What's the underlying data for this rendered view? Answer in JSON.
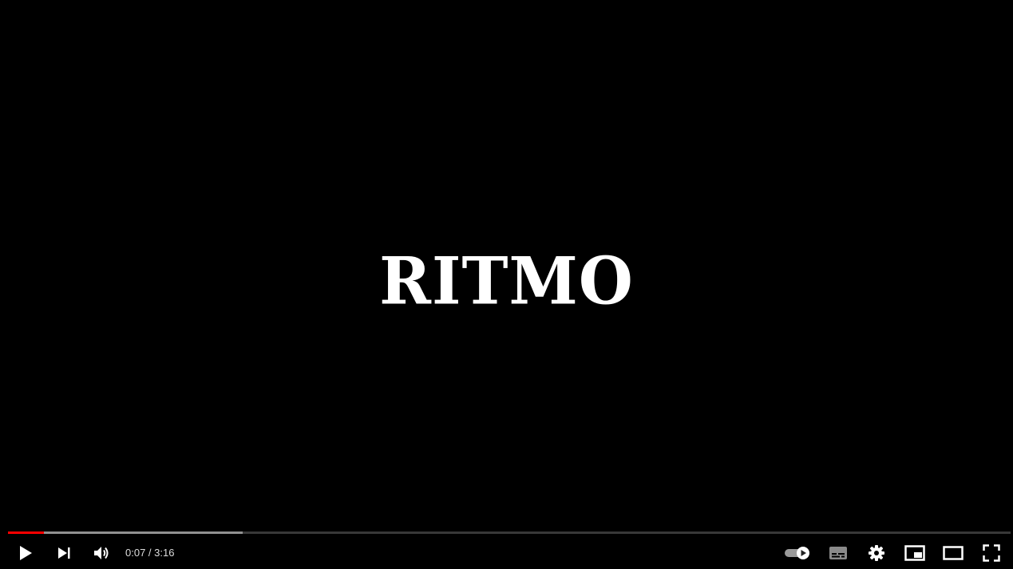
{
  "video": {
    "title_card": "RITMO"
  },
  "player": {
    "current_time": "0:07",
    "separator": " / ",
    "duration": "3:16",
    "progress_played_fraction": 0.036,
    "progress_buffered_fraction": 0.234,
    "accent_color": "#ff0000",
    "autoplay_enabled": true
  },
  "controls": {
    "left": [
      "play-icon",
      "next-icon",
      "volume-icon"
    ],
    "right": [
      "autoplay-toggle-icon",
      "subtitles-icon",
      "settings-gear-icon",
      "miniplayer-icon",
      "theater-mode-icon",
      "fullscreen-icon"
    ]
  }
}
